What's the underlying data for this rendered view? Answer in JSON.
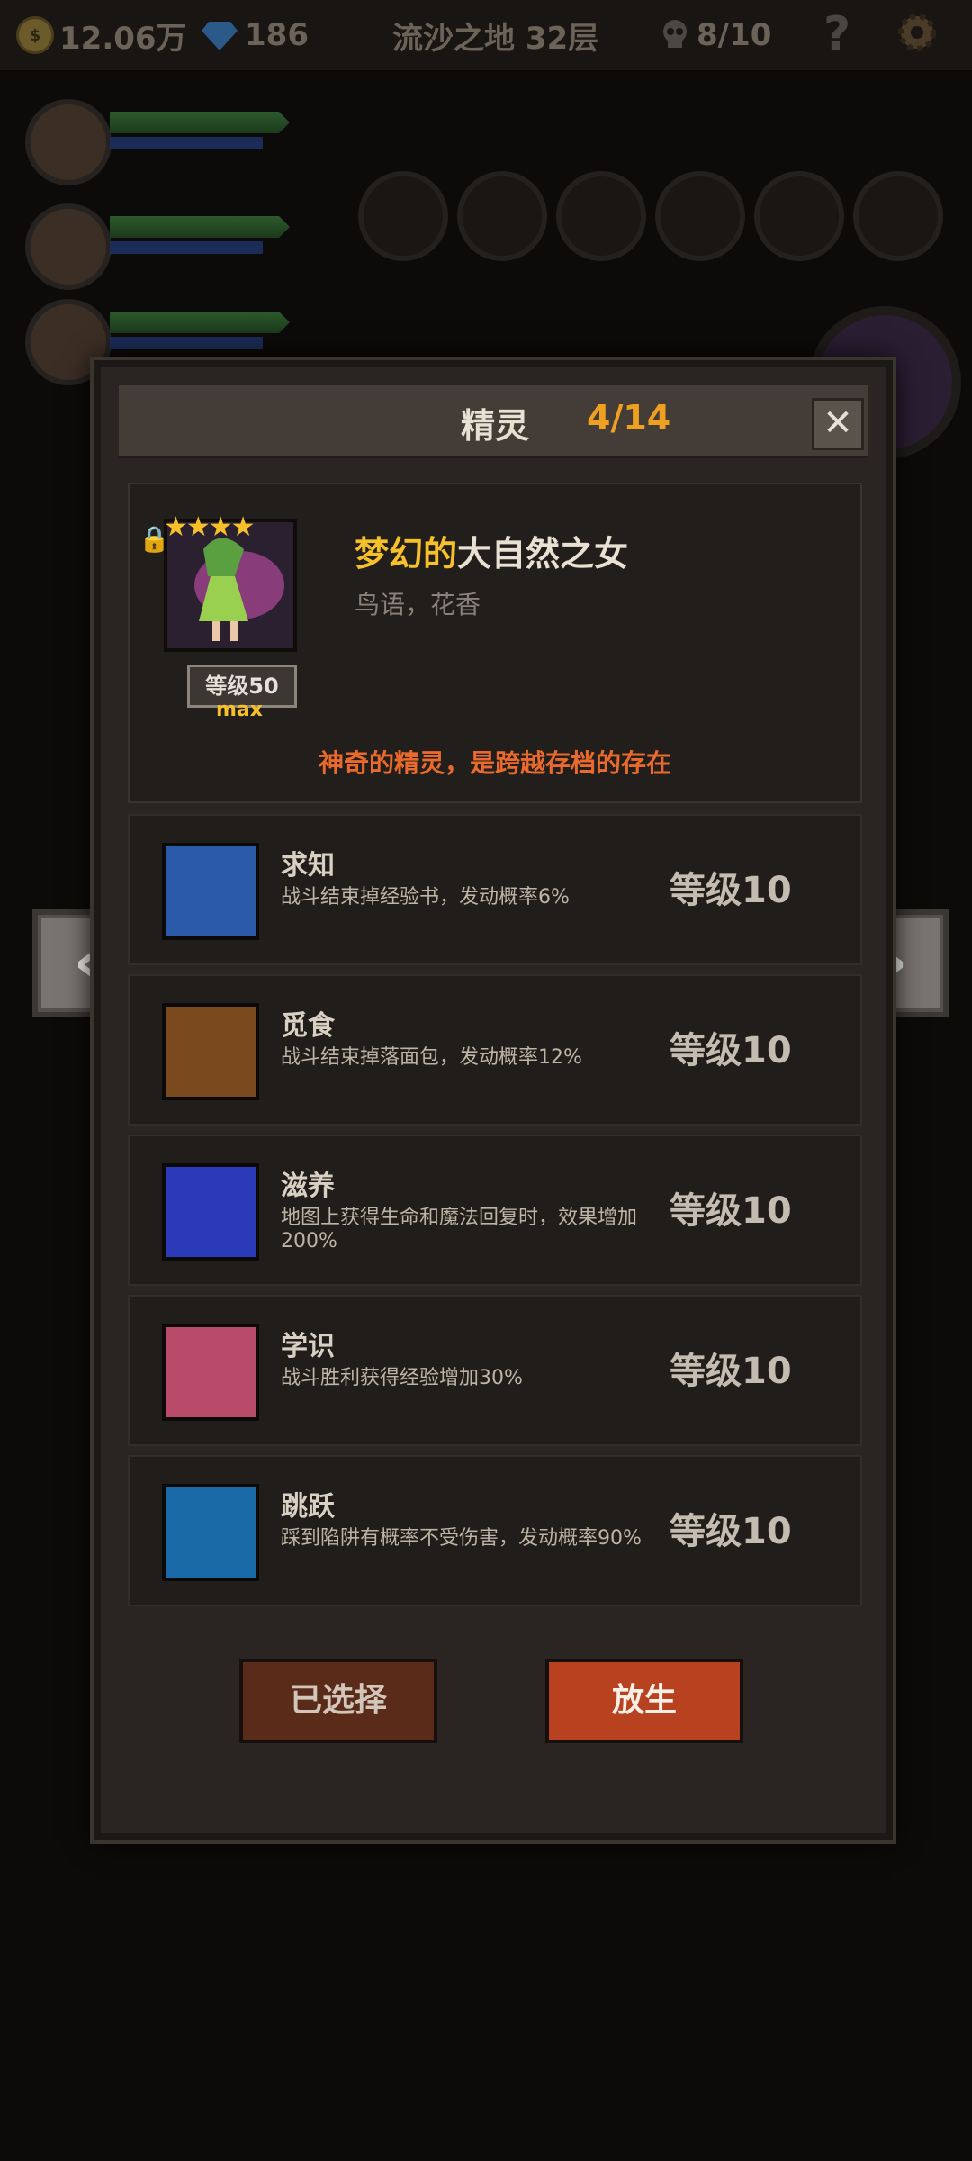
{
  "topbar": {
    "gold": "12.06万",
    "gems": "186",
    "location": "流沙之地 32层",
    "lives": "8/10",
    "help_label": "?"
  },
  "dialog": {
    "title": "精灵",
    "count": "4/14",
    "close_label": "✕"
  },
  "spirit": {
    "name_prefix": "梦幻的",
    "name_main": "大自然之女",
    "subtitle": "鸟语，花香",
    "stars": "★★★★",
    "level": "等级50",
    "max": "max",
    "description": "神奇的精灵，是跨越存档的存在"
  },
  "skills": [
    {
      "name": "求知",
      "desc": "战斗结束掉经验书，发动概率6%",
      "level": "等级10",
      "icon": "blue-book-icon",
      "color": "#2a5aa8"
    },
    {
      "name": "觅食",
      "desc": "战斗结束掉落面包，发动概率12%",
      "level": "等级10",
      "icon": "gingerbread-icon",
      "color": "#7a4a1e"
    },
    {
      "name": "滋养",
      "desc": "地图上获得生命和魔法回复时，效果增加200%",
      "level": "等级10",
      "icon": "fairies-icon",
      "color": "#2a3ab8"
    },
    {
      "name": "学识",
      "desc": "战斗胜利获得经验增加30%",
      "level": "等级10",
      "icon": "third-eye-face-icon",
      "color": "#b84a6a"
    },
    {
      "name": "跳跃",
      "desc": "踩到陷阱有概率不受伤害，发动概率90%",
      "level": "等级10",
      "icon": "leaping-legs-icon",
      "color": "#1a6aa8"
    }
  ],
  "buttons": {
    "selected": "已选择",
    "release": "放生"
  },
  "nav": {
    "prev": "‹",
    "next": "›"
  }
}
